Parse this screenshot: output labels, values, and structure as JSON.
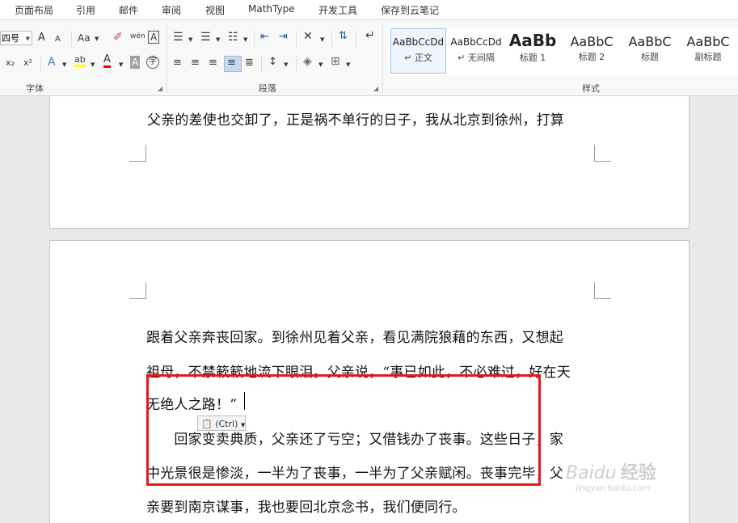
{
  "tabs": [
    "页面布局",
    "引用",
    "邮件",
    "审阅",
    "视图",
    "MathType",
    "开发工具",
    "保存到云笔记"
  ],
  "ribbon": {
    "font_size_value": "四号",
    "groups": {
      "font": "字体",
      "paragraph": "段落",
      "styles": "样式"
    },
    "font_buttons": {
      "grow": "A",
      "shrink": "A",
      "change_case": "Aa",
      "phonetic": "wén",
      "char_border": "A",
      "subscript": "x₂",
      "superscript": "x²",
      "text_effect": "A",
      "highlight": "ab",
      "font_color": "A",
      "char_shading": "A",
      "enclose": "字"
    },
    "accent_color": "#2b579a",
    "highlight_color": "#ffff00",
    "font_color_bar": "#ff0000",
    "styles": [
      {
        "sample": "AaBbCcDd",
        "name": "↵ 正文"
      },
      {
        "sample": "AaBbCcDd",
        "name": "↵ 无间隔"
      },
      {
        "sample": "AaBb",
        "name": "标题 1"
      },
      {
        "sample": "AaBbC",
        "name": "标题 2"
      },
      {
        "sample": "AaBbC",
        "name": "标题"
      },
      {
        "sample": "AaBbC",
        "name": "副标题"
      }
    ]
  },
  "document": {
    "page1_lines": [
      "父亲的差使也交卸了，正是祸不单行的日子，我从北京到徐州，打算"
    ],
    "page2_lines": [
      "跟着父亲奔丧回家。到徐州见着父亲，看见满院狼藉的东西，又想起",
      "祖母，不禁簌簌地流下眼泪。父亲说，“事已如此，不必难过，好在天",
      "无绝人之路！”",
      "　　回家变卖典质，父亲还了亏空；又借钱办了丧事。这些日子，家",
      "中光景很是惨淡，一半为了丧事，一半为了父亲赋闲。丧事完毕，父",
      "亲要到南京谋事，我也要回北京念书，我们便同行。"
    ],
    "paste_options_label": "(Ctrl)",
    "highlight_box_color": "#e11b1b"
  },
  "watermark": {
    "brand": "Baidu",
    "text": "经验",
    "url": "jingyan.baidu.com"
  }
}
